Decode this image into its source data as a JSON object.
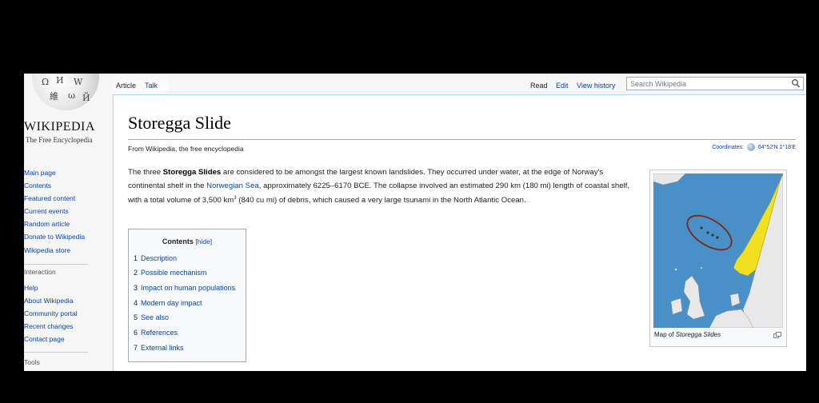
{
  "logo": {
    "wordmark": "WIKIPEDIA",
    "tagline": "The Free Encyclopedia",
    "glyphs": [
      "Ω",
      "И",
      "W",
      "維",
      "ω",
      "Й"
    ]
  },
  "sidebar": {
    "main_nav": [
      "Main page",
      "Contents",
      "Featured content",
      "Current events",
      "Random article",
      "Donate to Wikipedia",
      "Wikipedia store"
    ],
    "interaction_heading": "Interaction",
    "interaction_nav": [
      "Help",
      "About Wikipedia",
      "Community portal",
      "Recent changes",
      "Contact page"
    ],
    "tools_heading": "Tools"
  },
  "tabs": {
    "article": "Article",
    "talk": "Talk",
    "read": "Read",
    "edit": "Edit",
    "history": "View history"
  },
  "search": {
    "placeholder": "Search Wikipedia"
  },
  "article": {
    "title": "Storegga Slide",
    "from": "From Wikipedia, the free encyclopedia",
    "coordinates_label": "Coordinates:",
    "coordinates_value": "64°52′N 1°18′E",
    "intro": {
      "p1": "The three ",
      "bold": "Storegga Slides",
      "p2": " are considered to be amongst the largest known landslides. They occurred under water, at the edge of Norway's continental shelf in the ",
      "link": "Norwegian Sea",
      "p3": ", approximately 6225–6170 BCE. The collapse involved an estimated 290 km (180 mi) length of coastal shelf, with a total volume of 3,500 km",
      "sup": "3",
      "p4": " (840 cu mi) of debris, which caused a very large tsunami in the North Atlantic Ocean."
    }
  },
  "toc": {
    "title": "Contents",
    "hide": "[hide]",
    "items": [
      {
        "num": "1",
        "text": "Description"
      },
      {
        "num": "2",
        "text": "Possible mechanism"
      },
      {
        "num": "3",
        "text": "Impact on human populations"
      },
      {
        "num": "4",
        "text": "Modern day impact"
      },
      {
        "num": "5",
        "text": "See also"
      },
      {
        "num": "6",
        "text": "References"
      },
      {
        "num": "7",
        "text": "External links"
      }
    ]
  },
  "thumb": {
    "caption_prefix": "Map of ",
    "caption_italic": "Storegga Slides",
    "colors": {
      "sea": "#4a90c8",
      "norway": "#f0e020",
      "land": "#e8e8e8",
      "outline": "#7a2a1a"
    }
  }
}
